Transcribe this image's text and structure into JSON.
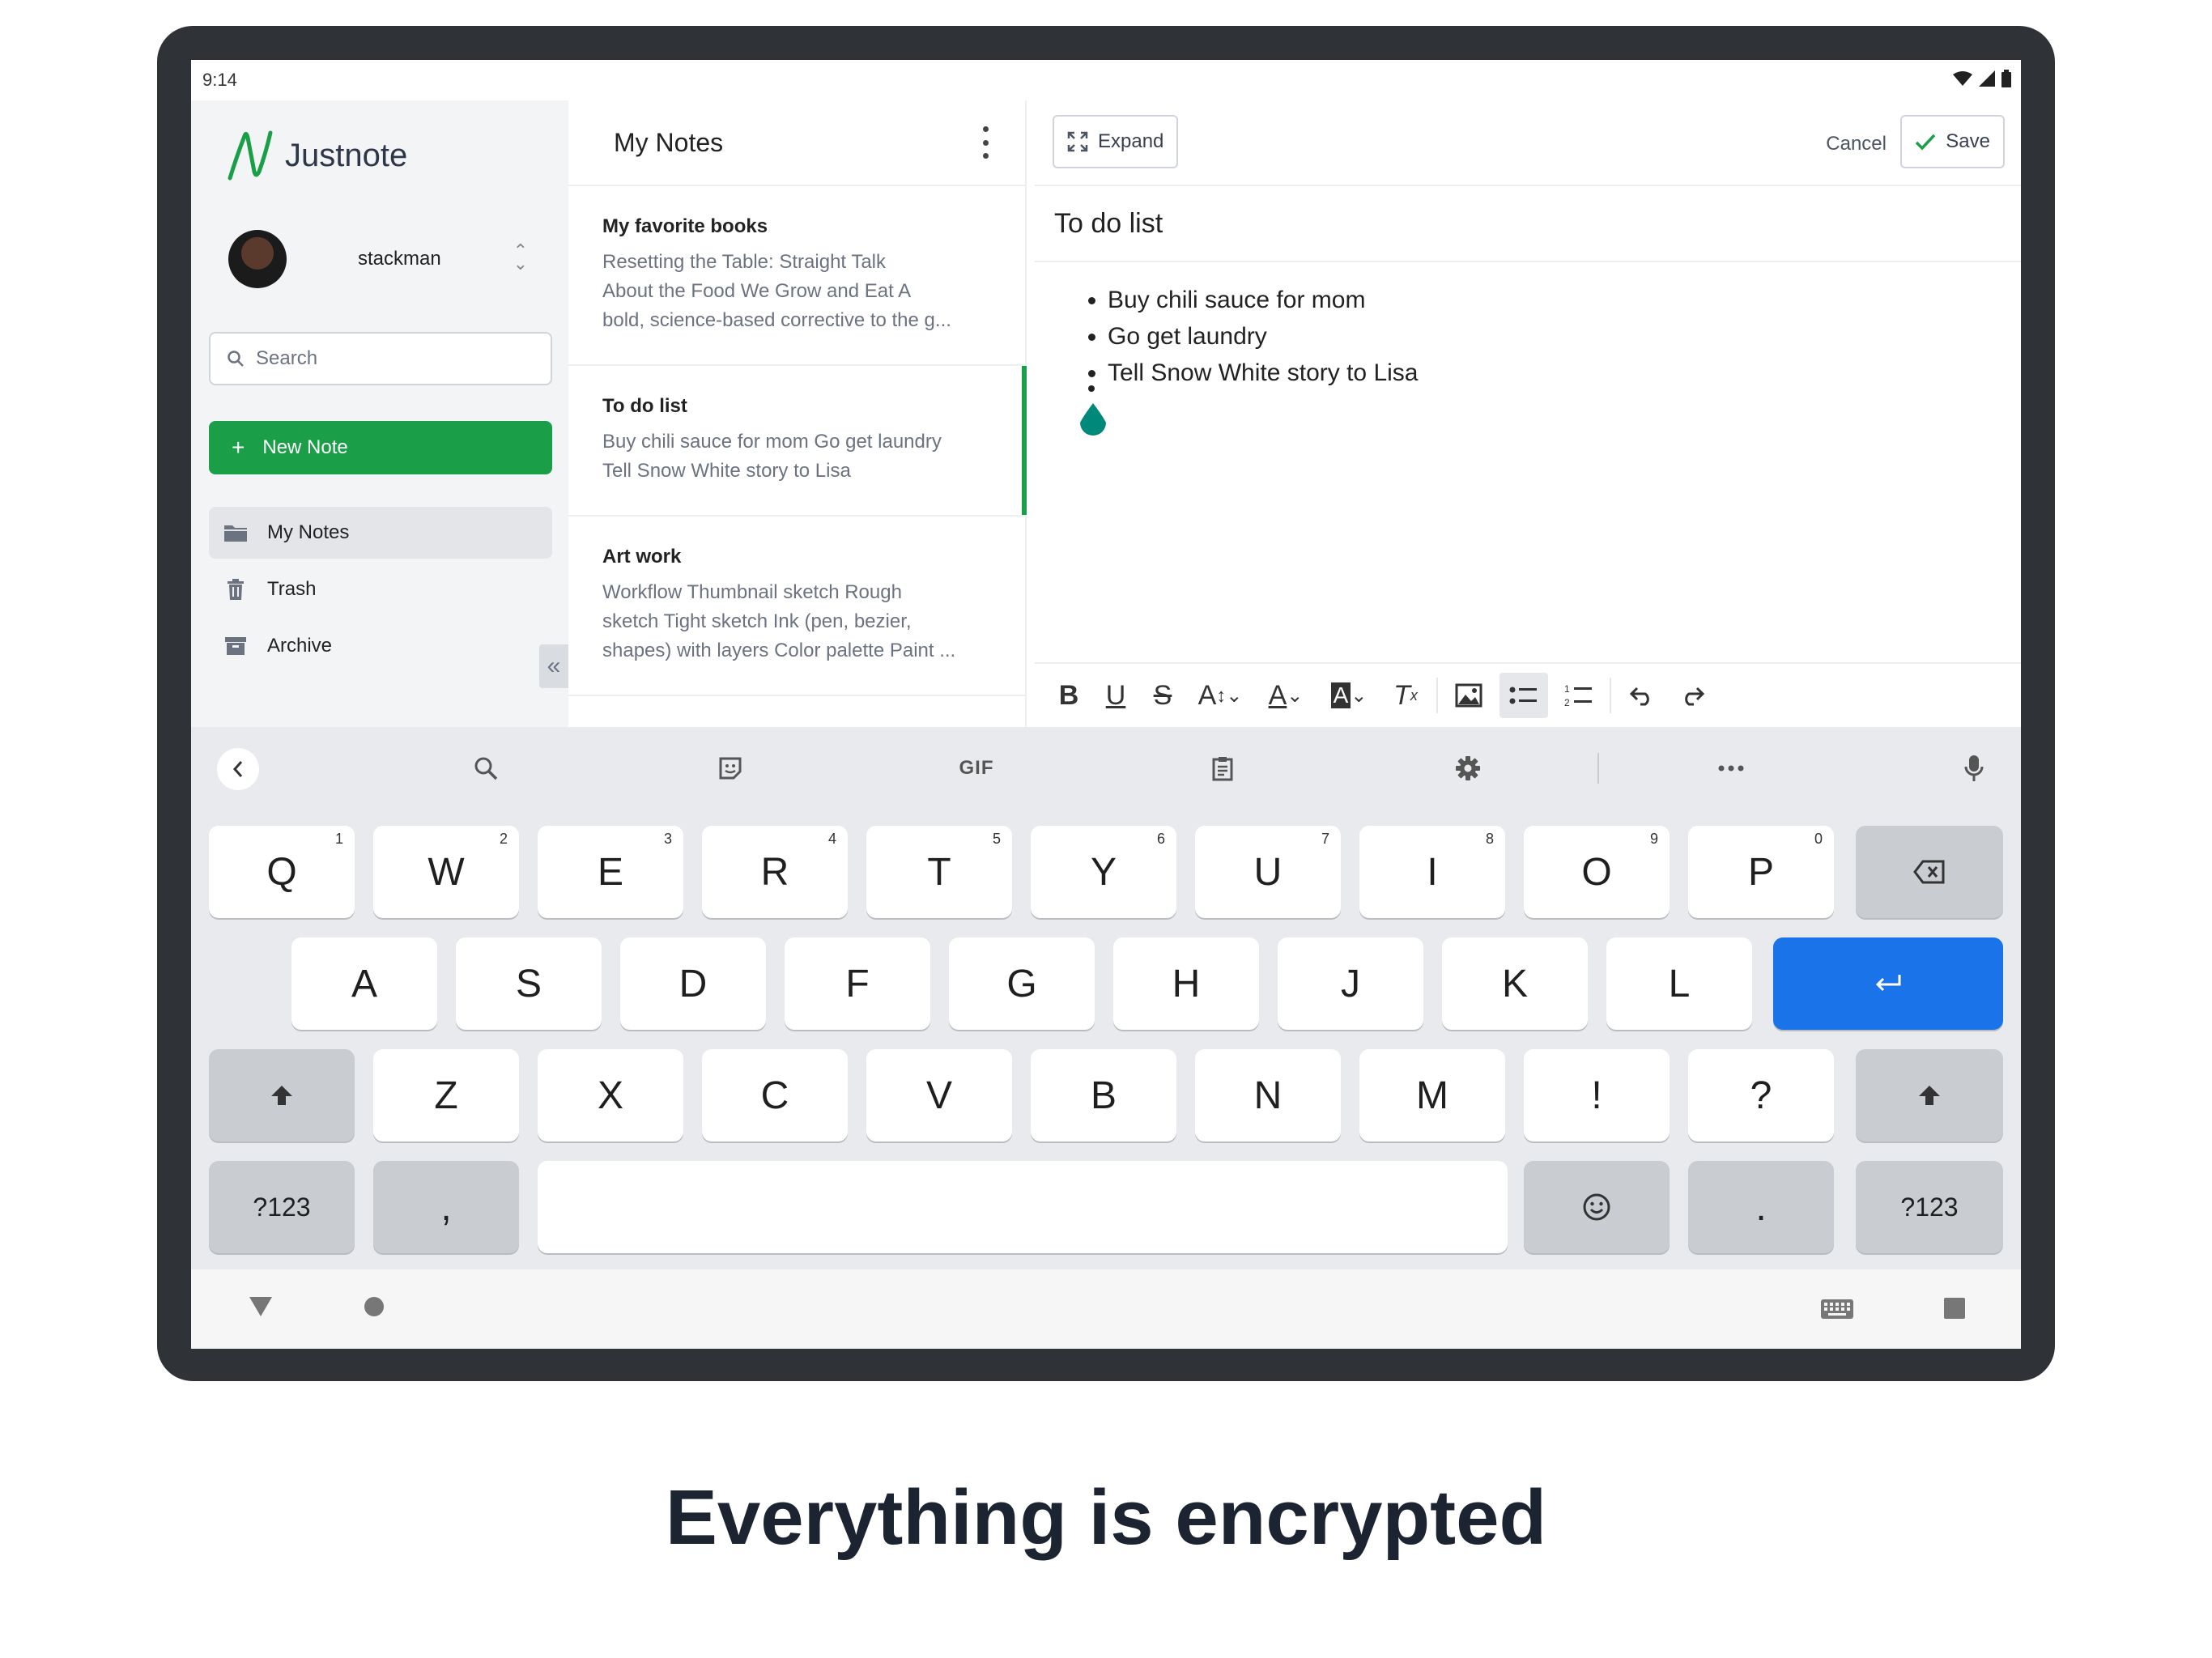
{
  "status_bar": {
    "time": "9:14"
  },
  "app": {
    "name": "Justnote",
    "brand_color": "#1a9e47"
  },
  "user": {
    "name": "stackman"
  },
  "search": {
    "placeholder": "Search"
  },
  "new_note_label": "New Note",
  "nav": [
    {
      "label": "My Notes",
      "icon": "folder-icon",
      "active": true
    },
    {
      "label": "Trash",
      "icon": "trash-icon"
    },
    {
      "label": "Archive",
      "icon": "archive-icon"
    }
  ],
  "note_list": {
    "title": "My Notes",
    "notes": [
      {
        "title": "My favorite books",
        "preview_lines": [
          "Resetting the Table: Straight Talk",
          "About the Food We Grow and Eat A",
          "bold, science-based corrective to the g..."
        ]
      },
      {
        "title": "To do list",
        "preview_lines": [
          "Buy chili sauce for mom Go get laundry",
          "Tell Snow White story to Lisa"
        ],
        "active": true
      },
      {
        "title": "Art work",
        "preview_lines": [
          "Workflow Thumbnail sketch Rough",
          "sketch Tight sketch Ink (pen, bezier,",
          "shapes) with layers Color palette Paint ..."
        ]
      }
    ]
  },
  "editor": {
    "expand_label": "Expand",
    "cancel_label": "Cancel",
    "save_label": "Save",
    "title": "To do list",
    "items": [
      "Buy chili sauce for mom",
      "Go get laundry",
      "Tell Snow White story to Lisa"
    ],
    "toolbar": [
      "bold-icon",
      "underline-icon",
      "strikethrough-icon",
      "font-size-icon",
      "text-color-icon",
      "highlight-icon",
      "clear-format-icon",
      "image-icon",
      "bulleted-list-icon",
      "numbered-list-icon",
      "undo-icon",
      "redo-icon"
    ],
    "font_size_glyph": "A",
    "text_color_glyph": "A",
    "highlight_glyph": "A",
    "clear_format_glyph": "T"
  },
  "keyboard": {
    "gif_label": "GIF",
    "row1": [
      {
        "k": "Q",
        "h": "1"
      },
      {
        "k": "W",
        "h": "2"
      },
      {
        "k": "E",
        "h": "3"
      },
      {
        "k": "R",
        "h": "4"
      },
      {
        "k": "T",
        "h": "5"
      },
      {
        "k": "Y",
        "h": "6"
      },
      {
        "k": "U",
        "h": "7"
      },
      {
        "k": "I",
        "h": "8"
      },
      {
        "k": "O",
        "h": "9"
      },
      {
        "k": "P",
        "h": "0"
      }
    ],
    "row2": [
      "A",
      "S",
      "D",
      "F",
      "G",
      "H",
      "J",
      "K",
      "L"
    ],
    "row3": [
      "Z",
      "X",
      "C",
      "V",
      "B",
      "N",
      "M",
      "!",
      "?"
    ],
    "symbols_label": "?123",
    "comma": ",",
    "period": "."
  },
  "caption": "Everything is encrypted"
}
